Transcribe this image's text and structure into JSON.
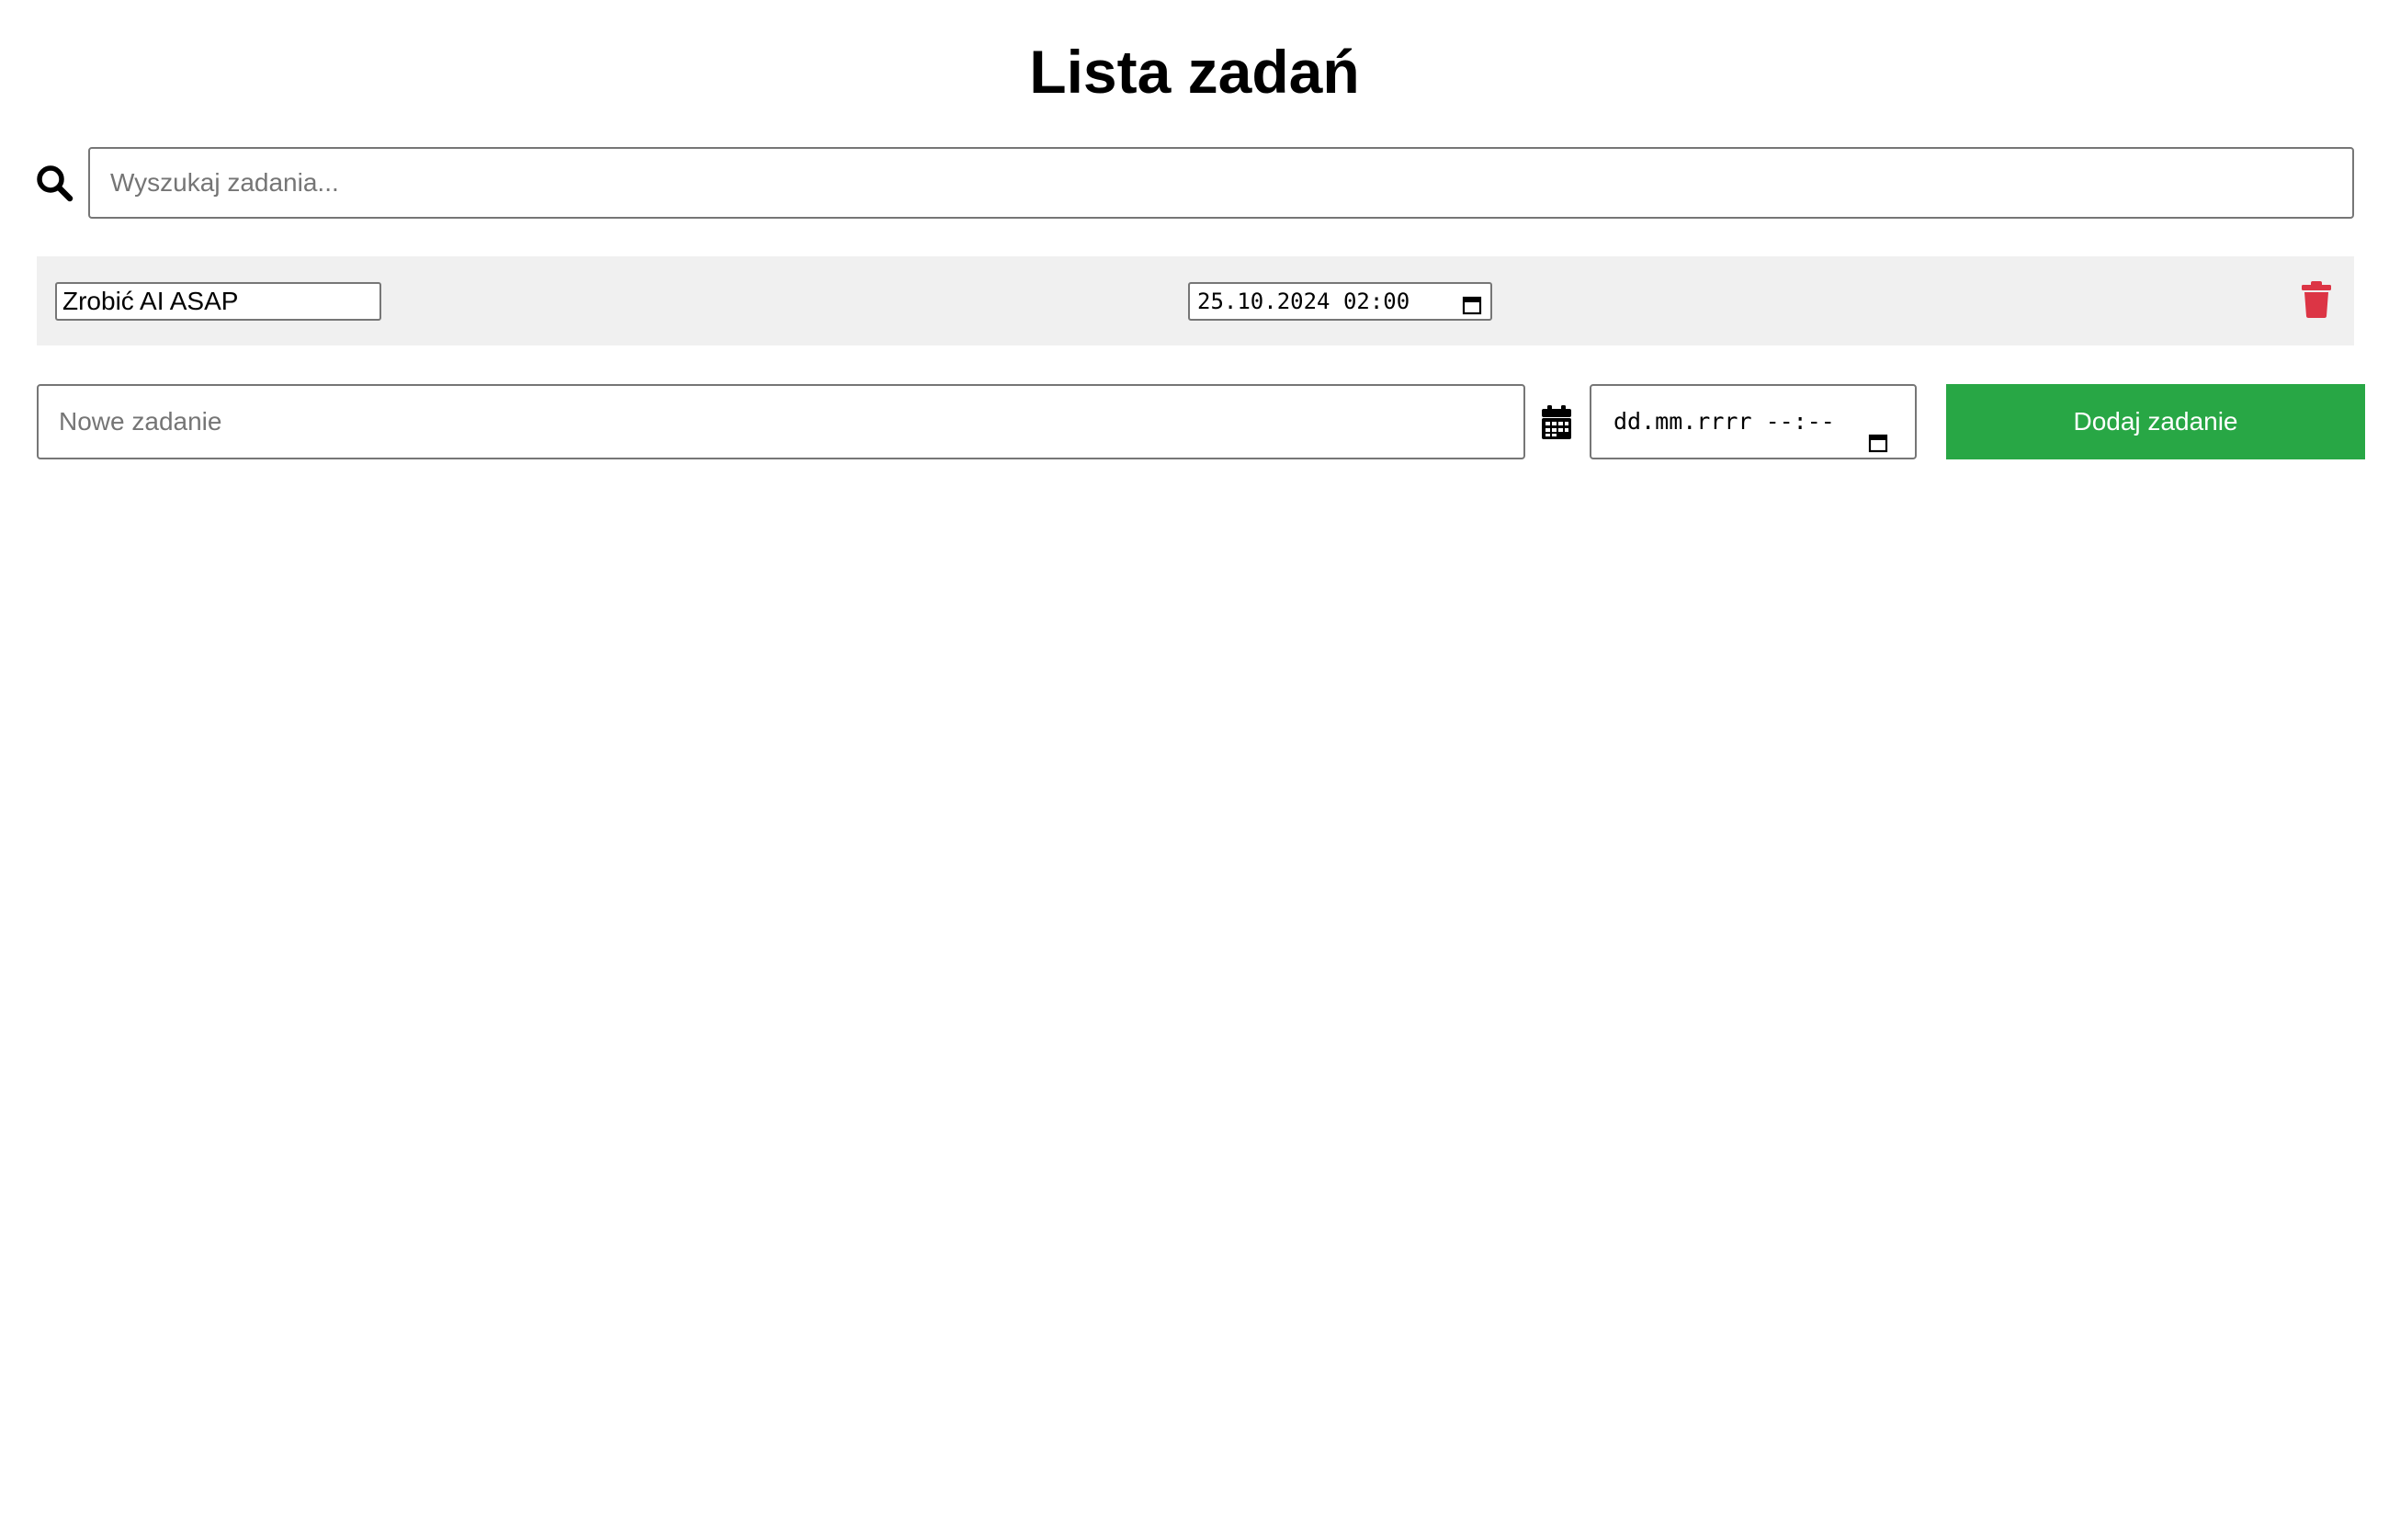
{
  "header": {
    "title": "Lista zadań"
  },
  "search": {
    "icon": "search-icon",
    "placeholder": "Wyszukaj zadania...",
    "value": ""
  },
  "tasks": [
    {
      "name": "Zrobić AI ASAP",
      "datetime": "25.10.2024 02:00",
      "delete_icon": "trash-icon"
    }
  ],
  "new_task": {
    "name_placeholder": "Nowe zadanie",
    "name_value": "",
    "calendar_icon": "calendar-icon",
    "datetime_placeholder": "dd.mm.rrrr --:--",
    "add_button_label": "Dodaj zadanie"
  },
  "colors": {
    "add_button": "#28a745",
    "delete_icon": "#dc3545",
    "task_row_background": "#f0f0f0"
  }
}
